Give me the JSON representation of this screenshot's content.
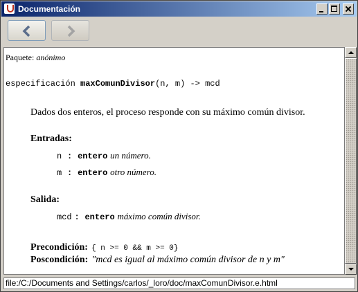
{
  "window": {
    "title": "Documentación"
  },
  "nav": {
    "back_label": "back",
    "forward_label": "forward"
  },
  "doc": {
    "package_label": "Paquete:",
    "package_value": "anónimo",
    "spec_keyword": "especificación",
    "function_name": "maxComunDivisor",
    "signature_rest": "(n, m) -> mcd",
    "description": "Dados dos enteros, el proceso responde con su máximo común divisor.",
    "inputs_heading": "Entradas:",
    "inputs": [
      {
        "name": "n",
        "sep": ":",
        "type": "entero",
        "desc": "un número."
      },
      {
        "name": "m",
        "sep": ":",
        "type": "entero",
        "desc": "otro número."
      }
    ],
    "output_heading": "Salida:",
    "output": {
      "name": "mcd",
      "sep": ":",
      "type": "entero",
      "desc": "máximo común divisor."
    },
    "precondition_label": "Precondición:",
    "precondition_value": "{ n >= 0 && m >= 0}",
    "postcondition_label": "Poscondición:",
    "postcondition_value": "\"mcd es igual al máximo común divisor de n y m\""
  },
  "status": {
    "path": "file:/C:/Documents and Settings/carlos/_loro/doc/maxComunDivisor.e.html"
  }
}
